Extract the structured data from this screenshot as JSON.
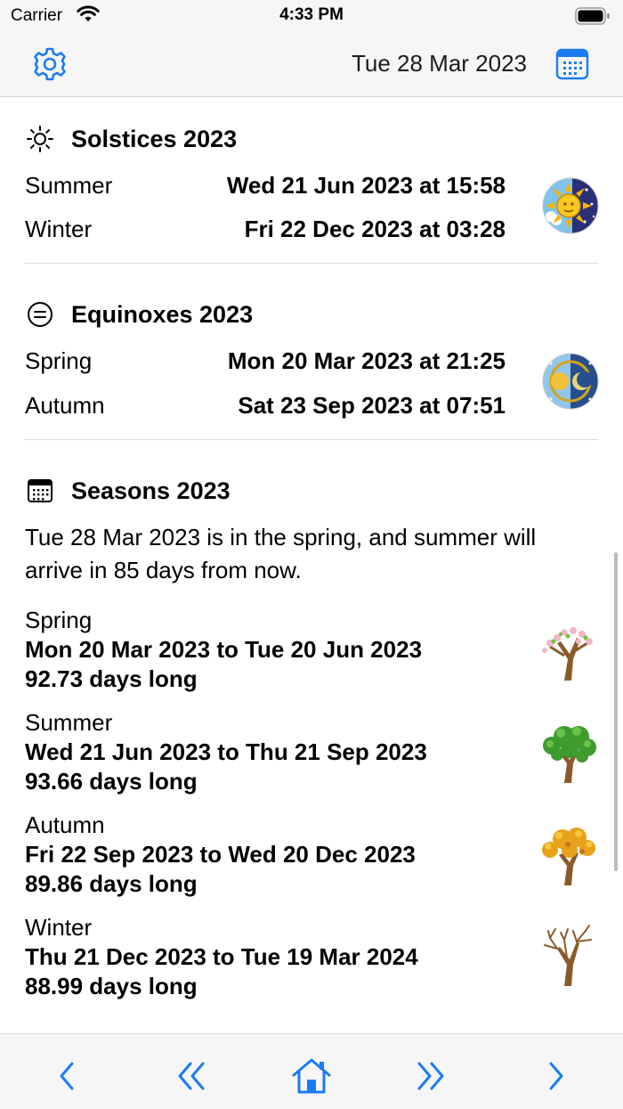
{
  "status_bar": {
    "carrier": "Carrier",
    "time": "4:33 PM"
  },
  "nav": {
    "date": "Tue 28 Mar 2023",
    "settings_icon": "gear-icon",
    "calendar_icon": "calendar-icon"
  },
  "colors": {
    "accent": "#1a7cf5",
    "text": "#000000",
    "divider": "#dcdcdc",
    "bar_bg": "#f6f6f6"
  },
  "solstices": {
    "title": "Solstices 2023",
    "icon": "sun-icon",
    "rows": [
      {
        "label": "Summer",
        "value": "Wed 21 Jun 2023 at 15:58"
      },
      {
        "label": "Winter",
        "value": "Fri 22 Dec 2023 at 03:28"
      }
    ]
  },
  "equinoxes": {
    "title": "Equinoxes 2023",
    "icon": "equal-circle-icon",
    "rows": [
      {
        "label": "Spring",
        "value": "Mon 20 Mar 2023 at 21:25"
      },
      {
        "label": "Autumn",
        "value": "Sat 23 Sep 2023 at 07:51"
      }
    ]
  },
  "seasons": {
    "title": "Seasons 2023",
    "icon": "calendar-icon",
    "summary": "Tue 28 Mar 2023 is in the spring, and summer will arrive in 85 days from now.",
    "items": [
      {
        "name": "Spring",
        "range": "Mon 20 Mar 2023 to Tue 20 Jun 2023",
        "length": "92.73 days long",
        "icon": "blossom-tree-icon"
      },
      {
        "name": "Summer",
        "range": "Wed 21 Jun 2023 to Thu 21 Sep 2023",
        "length": "93.66 days long",
        "icon": "green-tree-icon"
      },
      {
        "name": "Autumn",
        "range": "Fri 22 Sep 2023 to Wed 20 Dec 2023",
        "length": "89.86 days long",
        "icon": "autumn-tree-icon"
      },
      {
        "name": "Winter",
        "range": "Thu 21 Dec 2023 to Tue 19 Mar 2024",
        "length": "88.99 days long",
        "icon": "bare-tree-icon"
      }
    ]
  },
  "toolbar": {
    "buttons": [
      "chevron-left-icon",
      "double-chevron-left-icon",
      "home-icon",
      "double-chevron-right-icon",
      "chevron-right-icon"
    ]
  }
}
